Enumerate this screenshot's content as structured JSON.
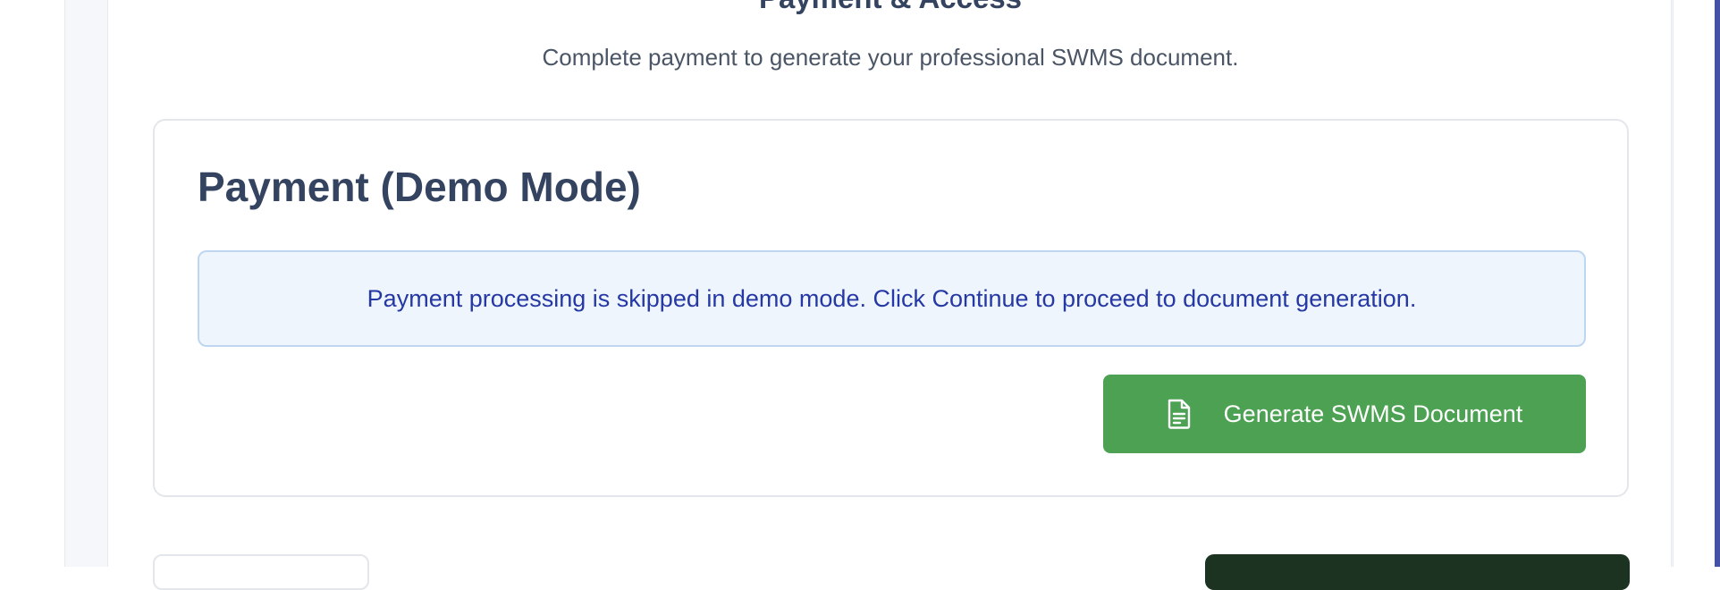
{
  "section": {
    "title": "Payment & Access",
    "subtitle": "Complete payment to generate your professional SWMS document."
  },
  "payment_card": {
    "title": "Payment (Demo Mode)",
    "info_message": "Payment processing is skipped in demo mode. Click Continue to proceed to document generation.",
    "generate_button_label": "Generate SWMS Document",
    "generate_button_icon": "document-icon"
  },
  "colors": {
    "heading": "#34435f",
    "info_text": "#2538a3",
    "info_bg": "#eef5fd",
    "button_green": "#4ca152",
    "dark_button": "#1b3320"
  }
}
